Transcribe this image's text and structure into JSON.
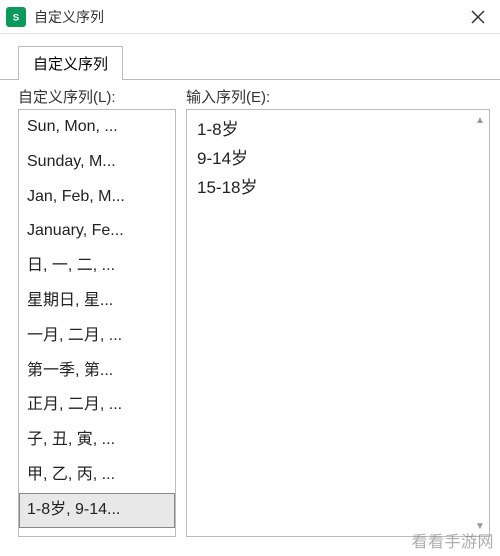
{
  "window": {
    "title": "自定义序列",
    "close_label": "关闭"
  },
  "tabs": [
    {
      "label": "自定义序列"
    }
  ],
  "left": {
    "label": "自定义序列(L):",
    "items": [
      "Sun, Mon, ...",
      "Sunday, M...",
      "Jan, Feb, M...",
      "January, Fe...",
      "日, 一, 二, ...",
      "星期日, 星...",
      "一月, 二月, ...",
      "第一季, 第...",
      "正月, 二月, ...",
      "子, 丑, 寅, ...",
      "甲, 乙, 丙, ...",
      "1-8岁, 9-14..."
    ],
    "selected_index": 11
  },
  "right": {
    "label": "输入序列(E):",
    "lines": [
      "1-8岁",
      "9-14岁",
      "15-18岁"
    ]
  },
  "watermark": "看看手游网"
}
